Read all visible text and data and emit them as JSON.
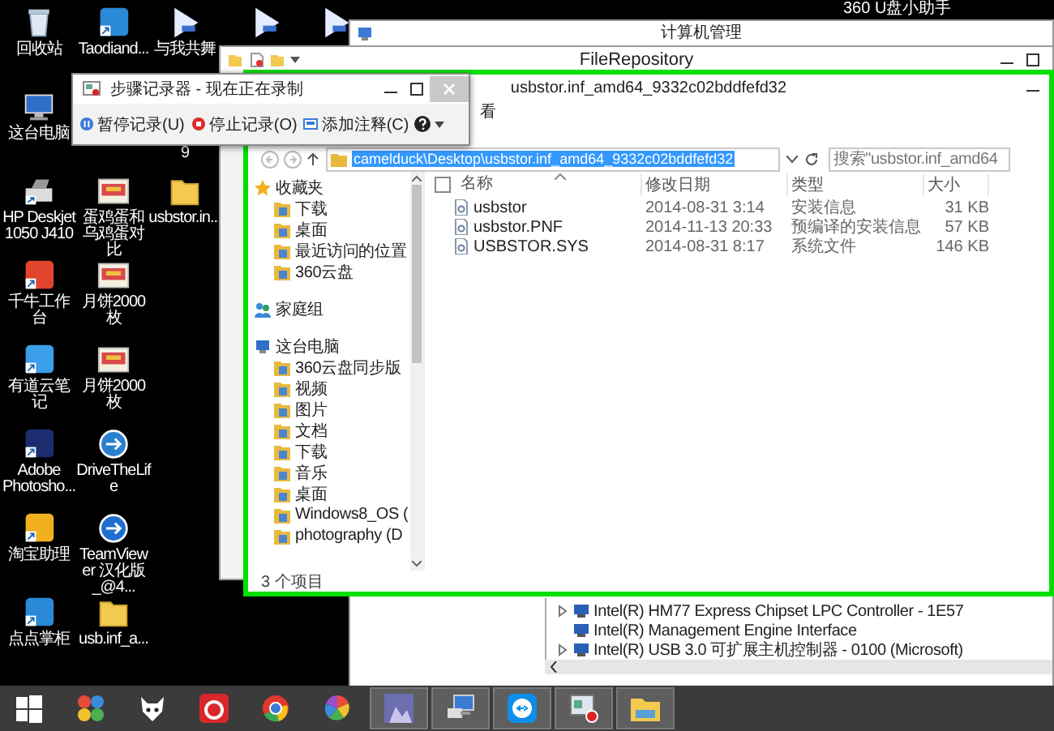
{
  "desktop_icons": [
    "回收站",
    "这台电脑",
    "HP Deskjet 1050 J410",
    "千牛工作台",
    "有道云笔记",
    "Adobe Photosho...",
    "淘宝助理",
    "点点掌柜",
    "Taodiand...",
    "蛋鸡蛋和乌鸡蛋对比",
    "月饼2000枚",
    "月饼2000枚",
    "DriveTheLife",
    "TeamViewer 汉化版_@4...",
    "usb.inf_a...",
    "与我共舞",
    "9",
    "usbstor.in..."
  ],
  "desktop_corner_label": "360 U盘小助手",
  "management_window": {
    "title": "计算机管理",
    "devices": [
      {
        "name": "Intel(R) HM77 Express Chipset LPC Controller - 1E57",
        "expandable": true
      },
      {
        "name": "Intel(R) Management Engine Interface",
        "expandable": false
      },
      {
        "name": "Intel(R) USB 3.0 可扩展主机控制器 - 0100 (Microsoft)",
        "expandable": true
      }
    ]
  },
  "repository_window": {
    "title": "FileRepository"
  },
  "explorer": {
    "title": "usbstor.inf_amd64_9332c02bddfefd32",
    "ribbon_tab": "看",
    "address": {
      "path": "camelduck\\Desktop\\usbstor.inf_amd64_9332c02bddfefd32",
      "selected": true
    },
    "search": {
      "placeholder": "搜索\"usbstor.inf_amd64"
    },
    "nav": [
      {
        "label": "收藏夹",
        "children": [
          {
            "label": "下载"
          },
          {
            "label": "桌面"
          },
          {
            "label": "最近访问的位置"
          },
          {
            "label": "360云盘"
          }
        ]
      },
      {
        "label": "家庭组"
      },
      {
        "label": "这台电脑",
        "children": [
          {
            "label": "360云盘同步版"
          },
          {
            "label": "视频"
          },
          {
            "label": "图片"
          },
          {
            "label": "文档"
          },
          {
            "label": "下载"
          },
          {
            "label": "音乐"
          },
          {
            "label": "桌面"
          },
          {
            "label": "Windows8_OS ("
          },
          {
            "label": "photography (D"
          }
        ]
      }
    ],
    "select_all": {
      "checked": false
    },
    "columns": [
      "名称",
      "修改日期",
      "类型",
      "大小"
    ],
    "files": [
      {
        "name": "usbstor",
        "modified": "2014-08-31 3:14",
        "type": "安装信息",
        "size": "31 KB"
      },
      {
        "name": "usbstor.PNF",
        "modified": "2014-11-13 20:33",
        "type": "预编译的安装信息",
        "size": "57 KB"
      },
      {
        "name": "USBSTOR.SYS",
        "modified": "2014-08-31 8:17",
        "type": "系统文件",
        "size": "146 KB"
      }
    ],
    "status": "3 个项目"
  },
  "recorder": {
    "title": "步骤记录器 - 现在正在录制",
    "buttons": [
      "暂停记录(U)",
      "停止记录(O)",
      "添加注释(C)"
    ]
  },
  "taskbar": [
    {
      "open": false
    },
    {
      "open": false
    },
    {
      "open": false
    },
    {
      "open": false
    },
    {
      "open": false
    },
    {
      "open": false
    },
    {
      "open": true
    },
    {
      "open": true
    },
    {
      "open": true
    },
    {
      "open": true
    },
    {
      "open": true
    }
  ]
}
